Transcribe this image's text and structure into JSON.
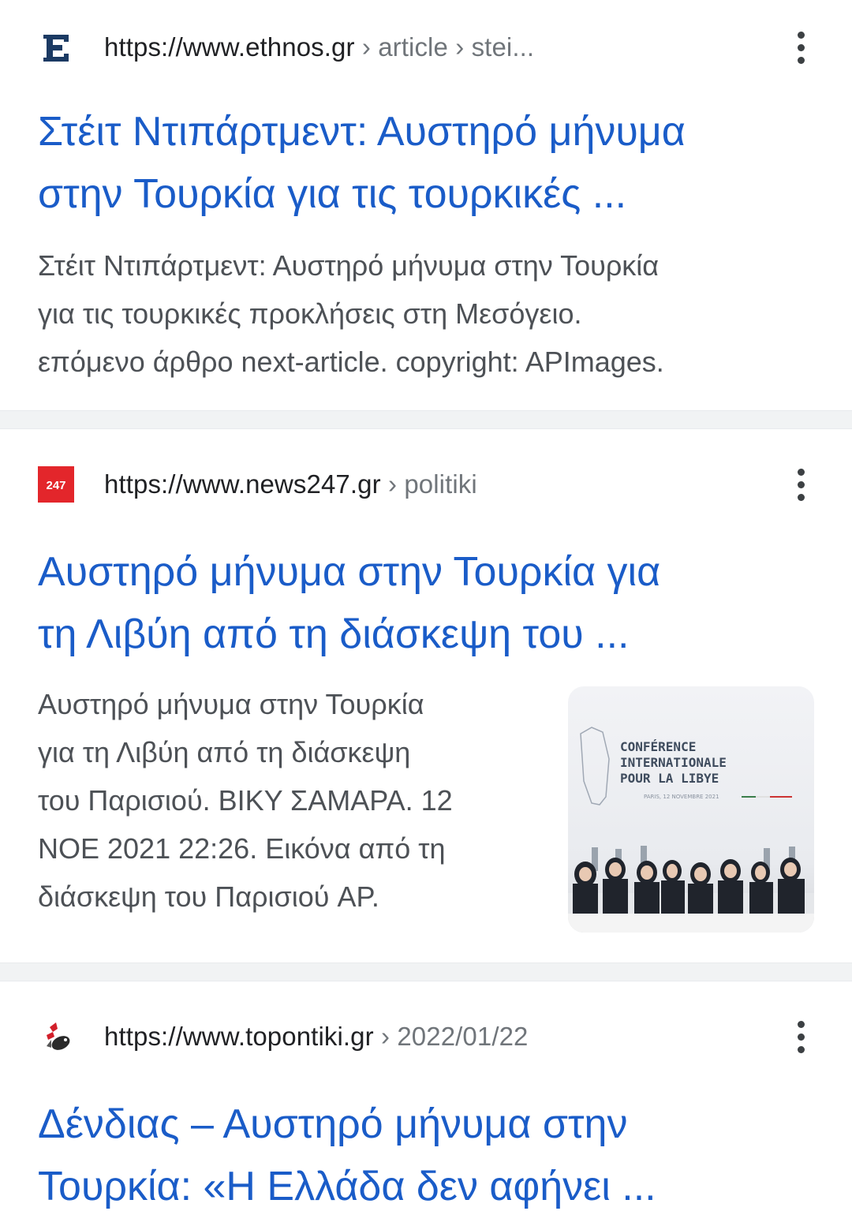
{
  "results": [
    {
      "domain": "https://www.ethnos.gr",
      "breadcrumb": " › article › stei...",
      "favicon": "ethnos-logo-icon",
      "title_line1": "Στέιτ Ντιπάρτμεντ: Αυστηρό μήνυμα",
      "title_line2": "στην Τουρκία για τις τουρκικές ...",
      "snippet_lines": [
        "Στέιτ Ντιπάρτμεντ: Αυστηρό μήνυμα στην Τουρκία",
        "για τις τουρκικές προκλήσεις στη Μεσόγειο.",
        "επόμενο άρθρο next-article. copyright: APImages."
      ]
    },
    {
      "domain": "https://www.news247.gr",
      "breadcrumb": " › politiki",
      "favicon": "news247-logo-icon",
      "favicon_text": "247",
      "title_line1": "Αυστηρό μήνυμα στην Τουρκία για",
      "title_line2": "τη Λιβύη από τη διάσκεψη του ...",
      "snippet_lines": [
        "Αυστηρό μήνυμα στην Τουρκία",
        "για τη Λιβύη από τη διάσκεψη",
        "του Παρισιού. ΒΙΚΥ ΣΑΜΑΡΑ. 12",
        "ΝΟΕ 2021 22:26. Εικόνα από τη",
        "διάσκεψη του Παρισιού AP."
      ],
      "thumbnail": {
        "line1": "CONFÉRENCE",
        "line2": "INTERNATIONALE",
        "line3": "POUR LA LIBYE",
        "line4": "PARIS, 12 NOVEMBRE 2021"
      }
    },
    {
      "domain": "https://www.topontiki.gr",
      "breadcrumb": " › 2022/01/22",
      "favicon": "topontiki-logo-icon",
      "title_line1": "Δένδιας – Αυστηρό μήνυμα στην",
      "title_line2": "Τουρκία: «Η Ελλάδα δεν αφήνει ..."
    }
  ],
  "colors": {
    "title": "#1a5cc8",
    "snippet": "#4d5156",
    "separator": "#f1f3f4"
  }
}
